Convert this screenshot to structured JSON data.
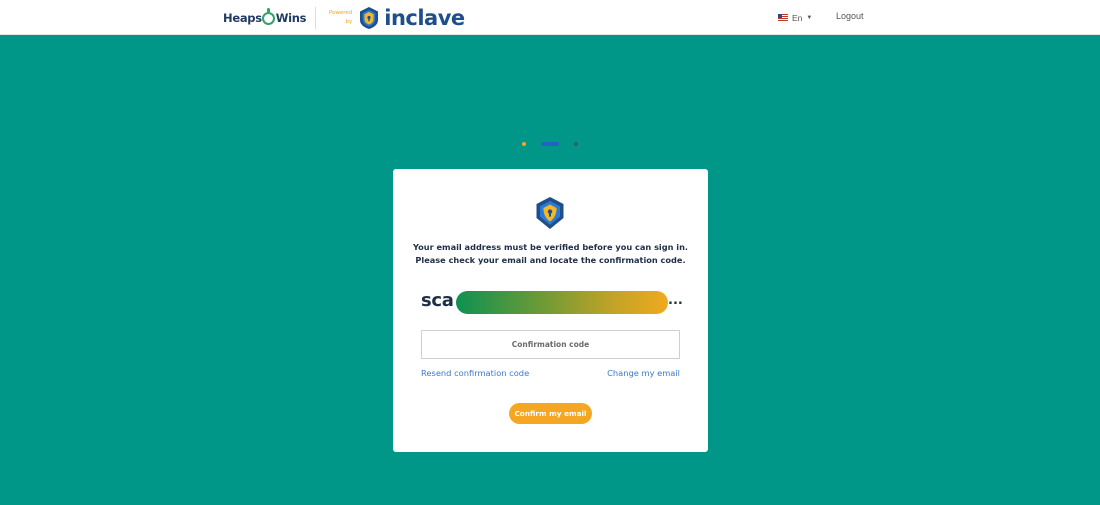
{
  "header": {
    "brand_left": {
      "part1": "Heaps",
      "part2": "Wins"
    },
    "powered_by": {
      "line1": "Powered",
      "line2": "by"
    },
    "brand_right": {
      "prefix": "i",
      "rest": "nclave"
    },
    "language": {
      "flag_icon": "us-flag-icon",
      "selected": "En"
    },
    "logout_label": "Logout"
  },
  "steps": {
    "total": 3,
    "current": 2
  },
  "card": {
    "icon": "inclave-shield-icon",
    "message_line1": "Your email address must be verified before you can sign in.",
    "message_line2": "Please check your email and locate the confirmation code.",
    "email_prefix": "sca",
    "email_suffix": "..."
  },
  "form": {
    "code_placeholder": "Confirmation code",
    "code_value": "",
    "resend_label": "Resend confirmation code",
    "change_email_label": "Change my email",
    "confirm_button_label": "Confirm my email"
  },
  "colors": {
    "background": "#009688",
    "accent": "#f5a623",
    "brand_blue": "#1e4f8a",
    "link": "#3a7ac9"
  }
}
